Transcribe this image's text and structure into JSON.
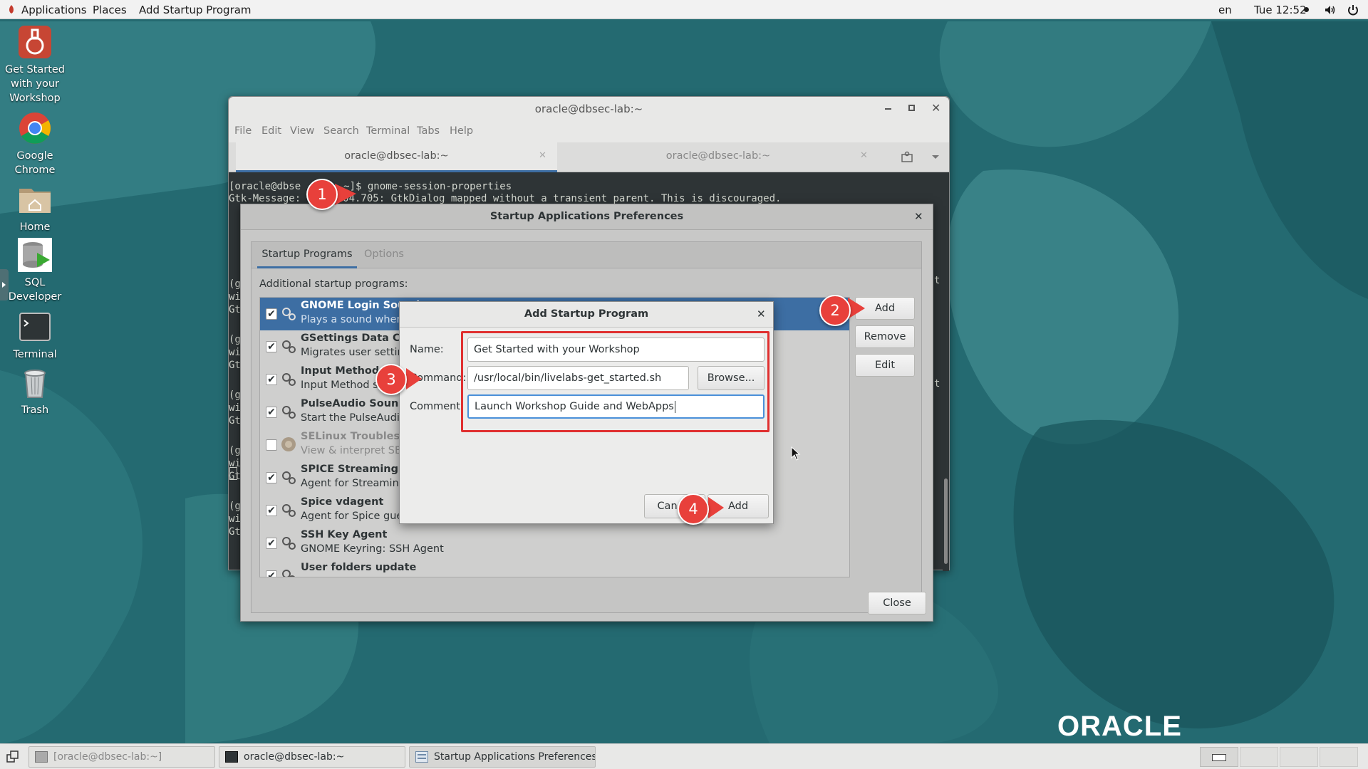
{
  "top_panel": {
    "applications": "Applications",
    "places": "Places",
    "active_app": "Add Startup Program",
    "language": "en",
    "clock": "Tue 12:52"
  },
  "desktop_icons": [
    {
      "label": "Get Started with your Workshop",
      "icon": "flask-icon"
    },
    {
      "label": "Google Chrome",
      "icon": "chrome-icon"
    },
    {
      "label": "Home",
      "icon": "home-folder-icon"
    },
    {
      "label": "SQL Developer",
      "icon": "sql-developer-icon"
    },
    {
      "label": "Terminal",
      "icon": "terminal-icon"
    },
    {
      "label": "Trash",
      "icon": "trash-icon"
    }
  ],
  "terminal": {
    "title": "oracle@dbsec-lab:~",
    "menu": [
      "File",
      "Edit",
      "View",
      "Search",
      "Terminal",
      "Tabs",
      "Help"
    ],
    "tabs": [
      {
        "label": "oracle@dbsec-lab:~"
      },
      {
        "label": "oracle@dbsec-lab:~"
      }
    ],
    "line1_prompt": "[oracle@dbse",
    "line1_cmd": "~]$ gnome-session-properties",
    "line2": "Gtk-Message: 12:52:04.705: GtkDialog mapped without a transient parent. This is discouraged.",
    "side_lines": [
      "(g",
      "wi",
      "Gt",
      "(g",
      "wi",
      "Gt",
      "(g",
      "wi",
      "Gt",
      "(g",
      "wi",
      "Gt",
      "(g",
      "wi",
      "Gt"
    ],
    "right_chars": [
      "t",
      "t"
    ]
  },
  "startup_prefs": {
    "title": "Startup Applications Preferences",
    "tabs": [
      "Startup Programs",
      "Options"
    ],
    "section_label": "Additional startup programs:",
    "programs": [
      {
        "name": "GNOME Login Sound",
        "desc": "Plays a sound whenever you log in",
        "checked": true,
        "selected": true
      },
      {
        "name": "GSettings Data Conversion",
        "desc": "Migrates user settings",
        "checked": true
      },
      {
        "name": "Input Method starter",
        "desc": "Input Method starter",
        "checked": true
      },
      {
        "name": "PulseAudio Sound System",
        "desc": "Start the PulseAudio Sound System",
        "checked": true
      },
      {
        "name": "SELinux Troubleshooter",
        "desc": "View & interpret SELinux denials",
        "checked": false
      },
      {
        "name": "SPICE Streaming Agent",
        "desc": "Agent for Streaming the framebuffer",
        "checked": true
      },
      {
        "name": "Spice vdagent",
        "desc": "Agent for Spice guests",
        "checked": true
      },
      {
        "name": "SSH Key Agent",
        "desc": "GNOME Keyring: SSH Agent",
        "checked": true
      },
      {
        "name": "User folders update",
        "desc": "",
        "checked": true
      }
    ],
    "buttons": {
      "add": "Add",
      "remove": "Remove",
      "edit": "Edit",
      "close": "Close"
    }
  },
  "add_dialog": {
    "title": "Add Startup Program",
    "name_label": "Name:",
    "name_value": "Get Started with your Workshop",
    "command_label": "Command:",
    "command_value": "/usr/local/bin/livelabs-get_started.sh",
    "browse": "Browse...",
    "comment_label": "Comment:",
    "comment_value": "Launch Workshop Guide and WebApps",
    "cancel": "Cancel",
    "add": "Add"
  },
  "callouts": [
    "1",
    "2",
    "3",
    "4"
  ],
  "watermark": "ORACLE",
  "taskbar": [
    {
      "label": "[oracle@dbsec-lab:~]"
    },
    {
      "label": "oracle@dbsec-lab:~"
    },
    {
      "label": "Startup Applications Preferences"
    }
  ],
  "colors": {
    "selection": "#3d6ea3",
    "callout": "#e8403b",
    "highlight_box": "#e03030",
    "focus": "#4a90d9"
  }
}
